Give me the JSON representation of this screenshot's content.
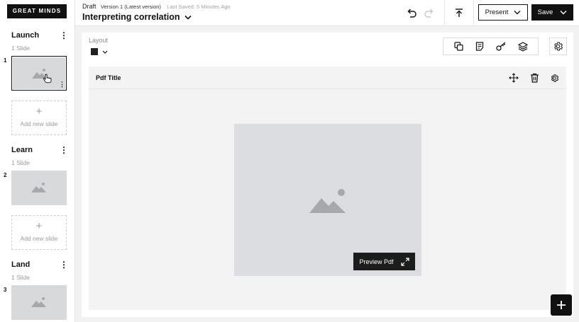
{
  "brand": {
    "logo_text": "GREAT MINDS"
  },
  "header": {
    "status": "Draft",
    "version": "Version 1 (Latest version)",
    "last_saved": "Last Saved: 5 Minutes Ago",
    "title": "Interpreting correlation",
    "present_label": "Present",
    "save_label": "Save"
  },
  "sidebar": {
    "add_slide_label": "Add new slide",
    "sections": [
      {
        "title": "Launch",
        "count": "1 Slide",
        "slide_number": "1"
      },
      {
        "title": "Learn",
        "count": "1 Slide",
        "slide_number": "2"
      },
      {
        "title": "Land",
        "count": "1 Slide",
        "slide_number": "3"
      }
    ]
  },
  "toolbar": {
    "layout_label": "Layout",
    "layout_color": "#222222"
  },
  "block": {
    "title": "Pdf Title",
    "preview_label": "Preview Pdf"
  },
  "icons": {
    "undo": "undo-icon",
    "redo": "redo-icon",
    "upload": "upload-icon",
    "copy": "copy-icon",
    "notes": "notes-icon",
    "key": "key-icon",
    "layers": "layers-icon",
    "settings": "gear-icon",
    "move": "move-icon",
    "delete": "trash-icon",
    "expand": "expand-icon",
    "add": "plus-icon",
    "image": "image-placeholder-icon"
  },
  "colors": {
    "accent": "#111111",
    "placeholder": "#dcdde0",
    "muted_text": "#9a9a9a"
  }
}
